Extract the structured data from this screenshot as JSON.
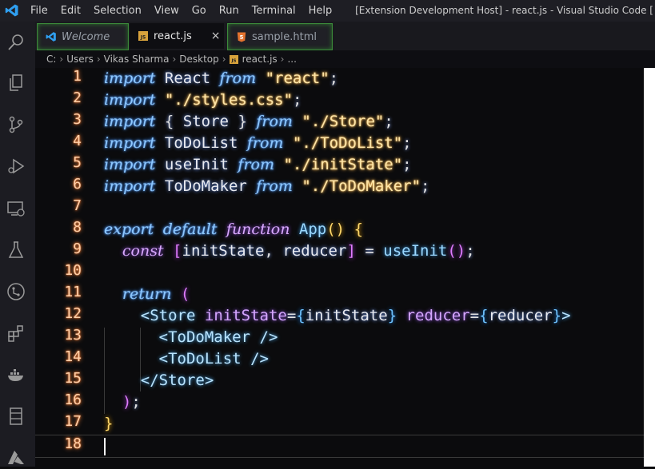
{
  "titlebar": {
    "menu": [
      "File",
      "Edit",
      "Selection",
      "View",
      "Go",
      "Run",
      "Terminal",
      "Help"
    ],
    "title": "[Extension Development Host] - react.js - Visual Studio Code ["
  },
  "activity_icons": [
    "files-icon",
    "source-control-icon",
    "run-debug-icon",
    "remote-explorer-icon",
    "testing-icon",
    "git-graph-icon",
    "extensions-icon",
    "docker-icon",
    "notebook-icon",
    "azure-icon"
  ],
  "tabs": [
    {
      "label": "Welcome",
      "icon": "vscode-icon"
    },
    {
      "label": "react.js",
      "icon": "js-icon",
      "active": true
    },
    {
      "label": "sample.html",
      "icon": "html5-icon"
    }
  ],
  "tab_close": "×",
  "breadcrumb": [
    "C:",
    "Users",
    "Vikas Sharma",
    "Desktop",
    "react.js",
    "..."
  ],
  "editor": {
    "line_numbers": [
      "1",
      "2",
      "3",
      "4",
      "5",
      "6",
      "7",
      "8",
      "9",
      "10",
      "11",
      "12",
      "13",
      "14",
      "15",
      "16",
      "17",
      "18"
    ],
    "lines": [
      "import React from \"react\";",
      "import \"./styles.css\";",
      "import { Store } from \"./Store\";",
      "import ToDoList from \"./ToDoList\";",
      "import useInit from \"./initState\";",
      "import ToDoMaker from \"./ToDoMaker\";",
      "",
      "export default function App() {",
      "  const [initState, reducer] = useInit();",
      "",
      "  return (",
      "    <Store initState={initState} reducer={reducer}>",
      "      <ToDoMaker />",
      "      <ToDoList />",
      "    </Store>",
      "  );",
      "}",
      ""
    ]
  },
  "tokens": {
    "import": "import",
    "from": "from",
    "export": "export",
    "default": "default",
    "function": "function",
    "const": "const",
    "return": "return",
    "react": "React",
    "react_str": "\"react\"",
    "styles_str": "\"./styles.css\"",
    "store": "Store",
    "store_str": "\"./Store\"",
    "todolist": "ToDoList",
    "todolist_str": "\"./ToDoList\"",
    "useinit": "useInit",
    "initstate_str": "\"./initState\"",
    "todomaker": "ToDoMaker",
    "todomaker_str": "\"./ToDoMaker\"",
    "app": "App",
    "initstate": "initState",
    "reducer": "reducer",
    "semi": ";"
  }
}
